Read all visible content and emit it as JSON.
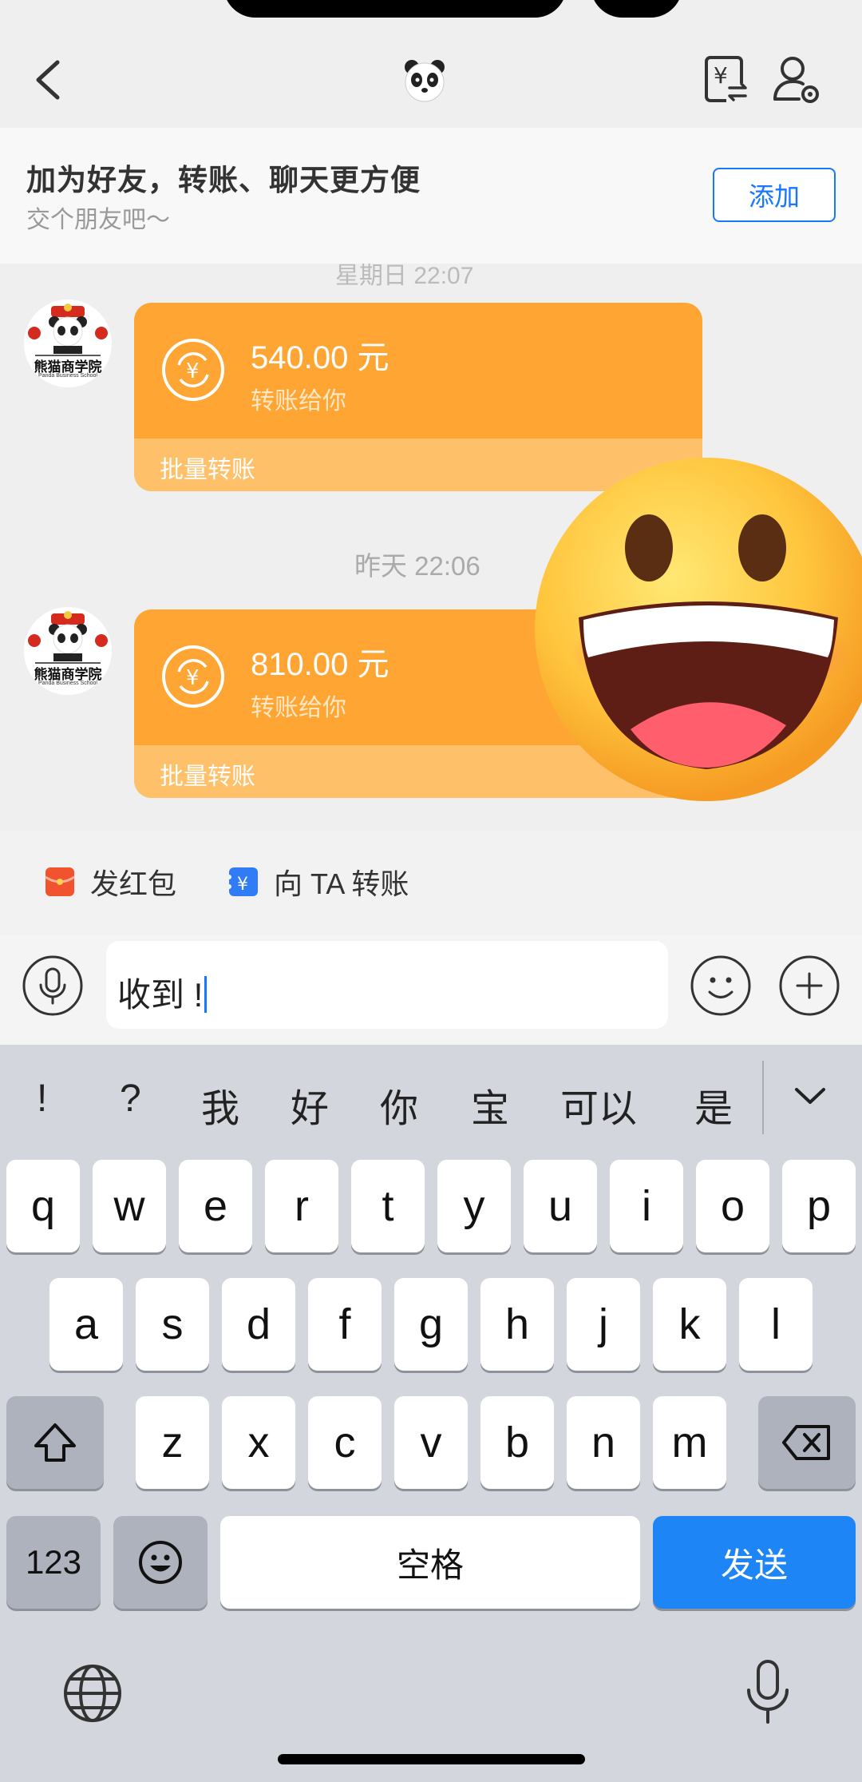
{
  "nav": {
    "back_icon": "chevron-left-icon",
    "avatar_icon": "panda-icon",
    "transfer_icon": "yuan-transfer-icon",
    "profile_icon": "user-settings-icon"
  },
  "banner": {
    "title": "加为好友，转账、聊天更方便",
    "subtitle": "交个朋友吧～",
    "add_label": "添加"
  },
  "chat": {
    "earlier_time": "星期日 22:07",
    "messages": [
      {
        "sender_logo_text": "熊猫商学院",
        "sender_logo_sub": "Panda Business School",
        "amount": "540.00 元",
        "note": "转账给你",
        "footer": "批量转账"
      },
      {
        "sender_logo_text": "熊猫商学院",
        "sender_logo_sub": "Panda Business School",
        "amount": "810.00 元",
        "note": "转账给你",
        "footer": "批量转账"
      }
    ],
    "time_divider": "昨天 22:06",
    "overlay_emoji": "grinning-face-icon"
  },
  "actions": {
    "red_packet": "发红包",
    "transfer": "向 TA 转账"
  },
  "input": {
    "value": "收到 !",
    "voice_icon": "microphone-icon",
    "emoji_icon": "smiley-icon",
    "more_icon": "plus-circle-icon"
  },
  "keyboard": {
    "candidates": [
      "!",
      "?",
      "我",
      "好",
      "你",
      "宝",
      "可以",
      "是"
    ],
    "row1": [
      "q",
      "w",
      "e",
      "r",
      "t",
      "y",
      "u",
      "i",
      "o",
      "p"
    ],
    "row2": [
      "a",
      "s",
      "d",
      "f",
      "g",
      "h",
      "j",
      "k",
      "l"
    ],
    "row3": [
      "z",
      "x",
      "c",
      "v",
      "b",
      "n",
      "m"
    ],
    "num_label": "123",
    "space_label": "空格",
    "send_label": "发送",
    "send_color": "#1d85f5"
  },
  "colors": {
    "card_orange": "#fea533",
    "card_footer": "#ffc06a",
    "accent_blue": "#1677ff"
  }
}
